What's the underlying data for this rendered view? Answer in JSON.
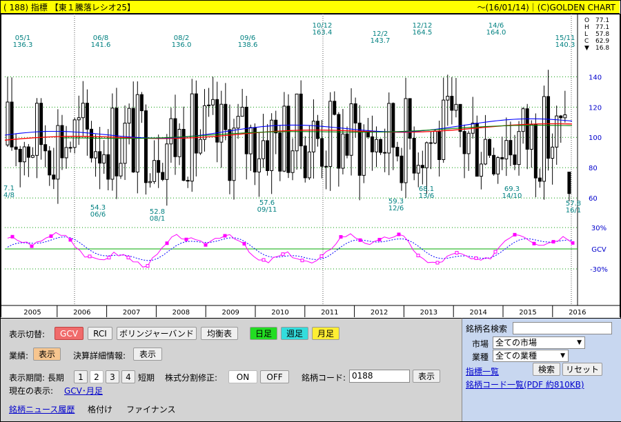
{
  "title": {
    "left": "( 188) 指標 【東１騰落レシオ25】",
    "right": "～(16/01/14)｜(C)GOLDEN CHART"
  },
  "ohlc": {
    "labels": [
      "O",
      "H",
      "L",
      "C",
      "▼"
    ],
    "values": [
      "77.1",
      "77.1",
      "57.8",
      "62.9",
      "16.8"
    ]
  },
  "chart_data": {
    "type": "candlestick",
    "main_axis": {
      "ticks": [
        60,
        80,
        100,
        120,
        140
      ],
      "range": [
        45,
        178
      ]
    },
    "gcv_axis": {
      "labels": [
        "30%",
        "GCV",
        "-30%"
      ]
    },
    "years": [
      "2005",
      "2006",
      "2007",
      "2008",
      "2009",
      "2010",
      "2011",
      "2012",
      "2013",
      "2014",
      "2015",
      "2016"
    ],
    "annotations_high": [
      {
        "value": "136.3",
        "date": "05/1"
      },
      {
        "value": "141.6",
        "date": "06/8"
      },
      {
        "value": "136.0",
        "date": "08/2"
      },
      {
        "value": "138.6",
        "date": "09/6"
      },
      {
        "value": "163.4",
        "date": "10/12"
      },
      {
        "value": "143.7",
        "date": "12/2"
      },
      {
        "value": "164.5",
        "date": "12/12"
      },
      {
        "value": "164.0",
        "date": "14/6"
      },
      {
        "value": "140.3",
        "date": "15/11"
      }
    ],
    "annotations_low": [
      {
        "value": "7.1",
        "date": "4/8"
      },
      {
        "value": "54.3",
        "date": "06/6"
      },
      {
        "value": "52.8",
        "date": "08/1"
      },
      {
        "value": "57.6",
        "date": "09/11"
      },
      {
        "value": "59.3",
        "date": "12/6"
      },
      {
        "value": "68.1",
        "date": "13/6"
      },
      {
        "value": "69.3",
        "date": "14/10"
      },
      {
        "value": "57.8",
        "date": "16/1"
      }
    ],
    "last_candle": {
      "open": 77.1,
      "high": 77.1,
      "low": 57.8,
      "close": 62.9
    }
  },
  "controls": {
    "switch_label": "表示切替:",
    "gcv": "GCV",
    "rci": "RCI",
    "bollinger": "ボリンジャーバンド",
    "ichimoku": "均衡表",
    "daily": "日足",
    "weekly": "週足",
    "monthly": "月足",
    "earnings_label": "業績:",
    "earnings_btn": "表示",
    "settlement_label": "決算詳細情報:",
    "settlement_btn": "表示",
    "period_label": "表示期間: 長期",
    "period_1": "1",
    "period_2": "2",
    "period_3": "3",
    "period_4": "4",
    "period_short": "短期",
    "split_label": "株式分割修正:",
    "on": "ON",
    "off": "OFF",
    "code_label": "銘柄コード:",
    "code_value": "0188",
    "code_btn": "表示",
    "current_label": "現在の表示:",
    "current_value": "GCV･月足",
    "news_link": "銘柄ニュース履歴",
    "rating": "格付け",
    "finance": "ファイナンス"
  },
  "search": {
    "title": "銘柄名検索",
    "market_label": "市場",
    "market_value": "全ての市場",
    "industry_label": "業種",
    "industry_value": "全ての業種",
    "search_btn": "検索",
    "reset_btn": "リセット",
    "index_link": "指標一覧",
    "code_list_link": "銘柄コード一覧(PDF 約810KB)"
  },
  "colors": {
    "title_bg": "#ffff00",
    "candle_label": "#008080",
    "red_ma": "#ff0000",
    "blue_ma": "#0000ff",
    "green_ma": "#008000",
    "gcv_line": "#ff00ff",
    "gcv_signal": "#0000ff",
    "grid_green": "#009900",
    "axis_label": "#0000cc"
  }
}
